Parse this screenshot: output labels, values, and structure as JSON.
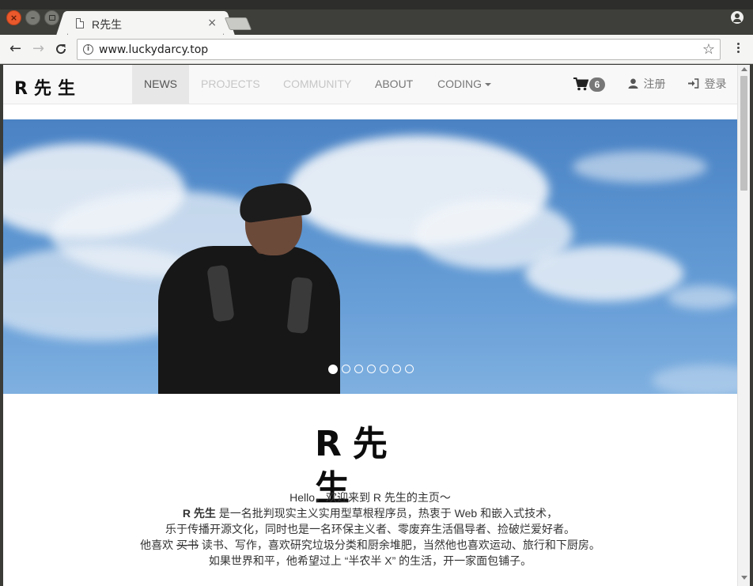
{
  "browser": {
    "tab_title": "R先生",
    "tab_close": "×",
    "url": "www.luckydarcy.top",
    "info_icon": "i",
    "star_icon": "☆",
    "back_icon": "←",
    "forward_icon": "→",
    "reload_icon": "C"
  },
  "navbar": {
    "brand": "R先生",
    "items": [
      {
        "label": "NEWS",
        "state": "active"
      },
      {
        "label": "PROJECTS",
        "state": "muted"
      },
      {
        "label": "COMMUNITY",
        "state": "muted"
      },
      {
        "label": "ABOUT",
        "state": "normal"
      },
      {
        "label": "CODING",
        "state": "dropdown"
      }
    ],
    "cart_count": "6",
    "register_label": "注册",
    "login_label": "登录"
  },
  "carousel": {
    "slide_count": 7,
    "active_index": 0
  },
  "intro": {
    "logo_text": "R先生",
    "line1": "Hello，欢迎来到 R 先生的主页〜",
    "line2_bold": "R 先生",
    "line2_rest": " 是一名批判现实主义实用型草根程序员，热衷于 Web 和嵌入式技术，",
    "line3": "乐于传播开源文化，同时也是一名环保主义者、零废弃生活倡导者、捡破烂爱好者。",
    "line4_prefix": "他喜欢 ",
    "line4_struck": "买书",
    "line4_rest": " 读书、写作，喜欢研究垃圾分类和厨余堆肥，当然他也喜欢运动、旅行和下厨房。",
    "line5": "如果世界和平，他希望过上 “半农半 X” 的生活，开一家面包铺子。"
  },
  "colors": {
    "navbar_bg": "#f8f8f8",
    "active_tab_bg": "#e7e7e7",
    "badge_bg": "#777777",
    "sky": "#5b94d0"
  }
}
